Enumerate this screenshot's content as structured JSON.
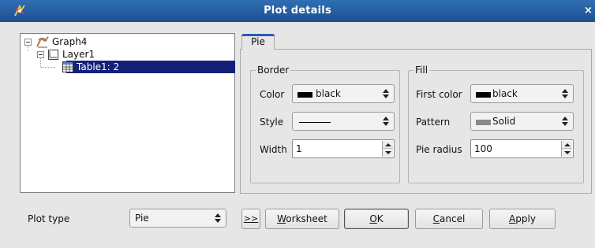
{
  "window": {
    "title": "Plot details",
    "close_glyph": "×"
  },
  "tree": {
    "items": [
      {
        "label": "Graph4",
        "icon": "graph-icon"
      },
      {
        "label": "Layer1",
        "icon": "layer-icon"
      },
      {
        "label": "Table1: 2",
        "icon": "table-icon",
        "selected": true
      }
    ]
  },
  "tabs": [
    {
      "label": "Pie",
      "active": true
    }
  ],
  "border": {
    "legend": "Border",
    "color_label": "Color",
    "color_value": "black",
    "style_label": "Style",
    "width_label": "Width",
    "width_value": "1"
  },
  "fill": {
    "legend": "Fill",
    "first_color_label": "First color",
    "first_color_value": "black",
    "pattern_label": "Pattern",
    "pattern_value": "Solid",
    "pie_radius_label": "Pie radius",
    "pie_radius_value": "100"
  },
  "footer": {
    "plot_type_label": "Plot type",
    "plot_type_value": "Pie",
    "more_button": ">>",
    "worksheet_mnemonic": "W",
    "worksheet_rest": "orksheet",
    "ok_mnemonic": "O",
    "ok_rest": "K",
    "cancel_mnemonic": "C",
    "cancel_rest": "ancel",
    "apply_mnemonic": "A",
    "apply_rest": "pply"
  },
  "colors": {
    "titlebar": "#1c4f91",
    "selection": "#12207a",
    "background": "#e6e6e6"
  }
}
